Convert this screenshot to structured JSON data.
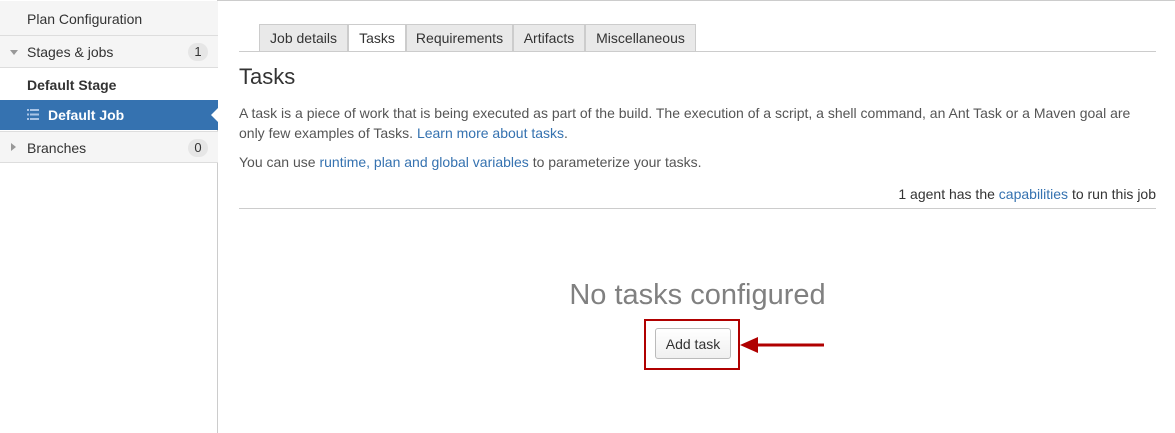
{
  "sidebar": {
    "plan_configuration": "Plan Configuration",
    "stages_label": "Stages & jobs",
    "stages_count": "1",
    "default_stage": "Default Stage",
    "default_job": "Default Job",
    "branches_label": "Branches",
    "branches_count": "0"
  },
  "tabs": [
    "Job details",
    "Tasks",
    "Requirements",
    "Artifacts",
    "Miscellaneous"
  ],
  "active_tab": "Tasks",
  "main": {
    "title": "Tasks",
    "description_prefix": "A task is a piece of work that is being executed as part of the build. The execution of a script, a shell command, an Ant Task or a Maven goal are only few examples of Tasks. ",
    "learn_more_link": "Learn more about tasks",
    "learn_more_suffix": ".",
    "variables_prefix": "You can use ",
    "variables_link": "runtime, plan and global variables",
    "variables_suffix": " to parameterize your tasks.",
    "agent_prefix": "1 agent has the ",
    "agent_link": "capabilities",
    "agent_suffix": " to run this job",
    "empty_state": "No tasks configured",
    "add_task_button": "Add task"
  },
  "colors": {
    "accent": "#3572b0",
    "highlight_box": "#b00000",
    "annotation_arrow": "#b00000"
  },
  "icons": {
    "job": "job-list-icon",
    "expand": "caret-down-icon",
    "collapse": "caret-right-icon",
    "annotation": "arrow-left-icon"
  }
}
